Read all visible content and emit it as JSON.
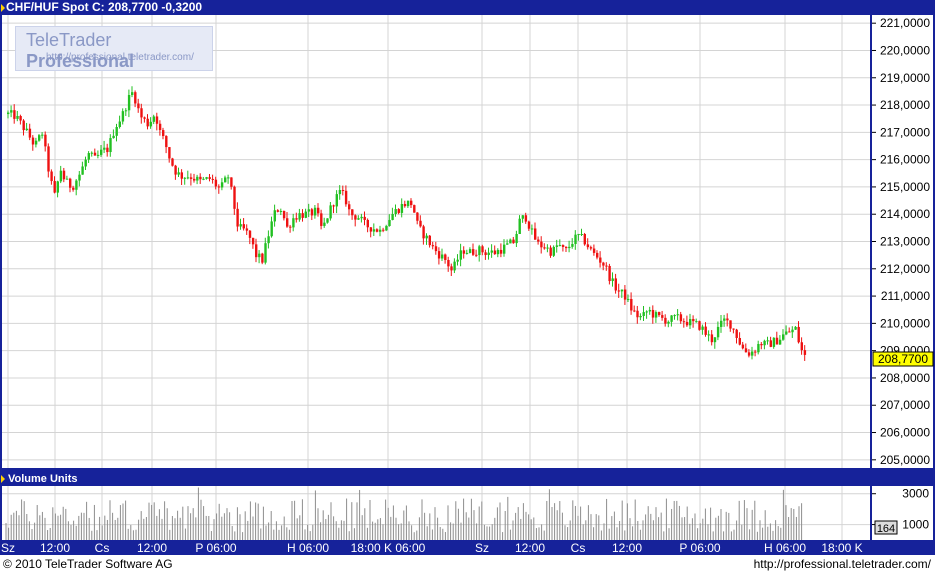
{
  "header": {
    "title": "CHF/HUF Spot C: 208,7700 -0,3200"
  },
  "logo": {
    "name_regular": "TeleTrader",
    "name_bold": "Professional",
    "url": "http://professional.teletrader.com/"
  },
  "volume_panel": {
    "title": "Volume Units",
    "last_value_label": "164"
  },
  "footer": {
    "copyright": "© 2010 TeleTrader Software AG",
    "url": "http://professional.teletrader.com/"
  },
  "colors": {
    "frame_blue": "#16229a",
    "up_candle": "#22c022",
    "down_candle": "#ee1111",
    "grid": "#d4d4d4",
    "last_price_highlight": "#ffff00"
  },
  "chart_data": [
    {
      "type": "candlestick",
      "title": "CHF/HUF Spot C: 208,7700 -0,3200",
      "last_value_label": "208,7700",
      "ylim": [
        204.7,
        221.3
      ],
      "yticks": [
        "221,0000",
        "220,0000",
        "219,0000",
        "218,0000",
        "217,0000",
        "216,0000",
        "215,0000",
        "214,0000",
        "213,0000",
        "212,0000",
        "211,0000",
        "210,0000",
        "209,0000",
        "208,0000",
        "207,0000",
        "206,0000",
        "205,0000"
      ],
      "ytick_values": [
        221,
        220,
        219,
        218,
        217,
        216,
        215,
        214,
        213,
        212,
        211,
        210,
        209,
        208,
        207,
        206,
        205
      ],
      "xticks": [
        "Sz",
        "12:00",
        "Cs",
        "12:00",
        "P 06:00",
        "H 06:00",
        "18:00 K 06:00",
        "Sz",
        "12:00",
        "Cs",
        "12:00",
        "P 06:00",
        "H 06:00",
        "18:00 K"
      ],
      "xtick_positions": [
        8,
        55,
        102,
        152,
        216,
        308,
        388,
        482,
        530,
        578,
        627,
        700,
        785,
        842
      ],
      "grid": true,
      "close_path": [
        [
          5,
          217.7
        ],
        [
          15,
          217.6
        ],
        [
          25,
          217.1
        ],
        [
          35,
          216.5
        ],
        [
          42,
          217.0
        ],
        [
          50,
          215.3
        ],
        [
          55,
          214.6
        ],
        [
          60,
          215.7
        ],
        [
          65,
          215.2
        ],
        [
          72,
          215.0
        ],
        [
          80,
          215.5
        ],
        [
          88,
          216.2
        ],
        [
          95,
          216.0
        ],
        [
          102,
          216.3
        ],
        [
          108,
          216.4
        ],
        [
          115,
          217.2
        ],
        [
          122,
          217.6
        ],
        [
          128,
          218.2
        ],
        [
          133,
          218.5
        ],
        [
          140,
          217.6
        ],
        [
          148,
          217.3
        ],
        [
          155,
          217.7
        ],
        [
          160,
          217.0
        ],
        [
          165,
          216.6
        ],
        [
          170,
          216.0
        ],
        [
          175,
          215.6
        ],
        [
          180,
          215.4
        ],
        [
          190,
          215.4
        ],
        [
          200,
          215.2
        ],
        [
          210,
          215.3
        ],
        [
          220,
          214.9
        ],
        [
          228,
          215.4
        ],
        [
          232,
          214.7
        ],
        [
          238,
          213.5
        ],
        [
          245,
          213.4
        ],
        [
          250,
          213.1
        ],
        [
          256,
          212.5
        ],
        [
          262,
          212.3
        ],
        [
          268,
          213.2
        ],
        [
          274,
          214.0
        ],
        [
          280,
          214.3
        ],
        [
          287,
          213.5
        ],
        [
          294,
          213.9
        ],
        [
          300,
          214.0
        ],
        [
          308,
          214.0
        ],
        [
          316,
          214.1
        ],
        [
          322,
          213.4
        ],
        [
          328,
          214.0
        ],
        [
          334,
          214.5
        ],
        [
          340,
          214.8
        ],
        [
          345,
          214.6
        ],
        [
          350,
          214.0
        ],
        [
          358,
          213.9
        ],
        [
          365,
          213.6
        ],
        [
          372,
          213.5
        ],
        [
          380,
          213.4
        ],
        [
          386,
          213.7
        ],
        [
          392,
          214.0
        ],
        [
          398,
          214.2
        ],
        [
          405,
          214.4
        ],
        [
          412,
          214.4
        ],
        [
          418,
          213.5
        ],
        [
          425,
          213.2
        ],
        [
          432,
          212.8
        ],
        [
          440,
          212.5
        ],
        [
          446,
          212.3
        ],
        [
          452,
          211.9
        ],
        [
          458,
          212.4
        ],
        [
          464,
          212.7
        ],
        [
          470,
          212.6
        ],
        [
          478,
          212.7
        ],
        [
          486,
          212.6
        ],
        [
          495,
          212.6
        ],
        [
          505,
          212.8
        ],
        [
          514,
          213.0
        ],
        [
          520,
          213.8
        ],
        [
          526,
          213.9
        ],
        [
          532,
          213.3
        ],
        [
          538,
          212.9
        ],
        [
          545,
          212.8
        ],
        [
          552,
          212.6
        ],
        [
          558,
          212.9
        ],
        [
          565,
          212.6
        ],
        [
          572,
          213.0
        ],
        [
          578,
          213.2
        ],
        [
          585,
          213.0
        ],
        [
          592,
          212.6
        ],
        [
          598,
          212.4
        ],
        [
          605,
          212.1
        ],
        [
          612,
          211.5
        ],
        [
          618,
          211.2
        ],
        [
          625,
          211.0
        ],
        [
          630,
          210.6
        ],
        [
          636,
          210.3
        ],
        [
          642,
          210.2
        ],
        [
          648,
          210.5
        ],
        [
          654,
          210.3
        ],
        [
          660,
          210.2
        ],
        [
          668,
          210.1
        ],
        [
          676,
          210.2
        ],
        [
          684,
          210.1
        ],
        [
          692,
          210.0
        ],
        [
          700,
          209.9
        ],
        [
          706,
          209.6
        ],
        [
          712,
          209.4
        ],
        [
          718,
          209.8
        ],
        [
          724,
          210.1
        ],
        [
          730,
          210.0
        ],
        [
          736,
          209.6
        ],
        [
          742,
          209.1
        ],
        [
          748,
          208.9
        ],
        [
          754,
          209.0
        ],
        [
          760,
          209.3
        ],
        [
          766,
          209.2
        ],
        [
          772,
          209.3
        ],
        [
          778,
          209.4
        ],
        [
          784,
          209.6
        ],
        [
          790,
          209.7
        ],
        [
          796,
          209.8
        ],
        [
          800,
          209.1
        ],
        [
          805,
          208.77
        ]
      ]
    },
    {
      "type": "bar",
      "title": "Volume Units",
      "ylim": [
        0,
        3500
      ],
      "yticks": [
        "3000",
        "1000"
      ],
      "ytick_values": [
        3000,
        1000
      ],
      "grid": true,
      "last_value": 164
    }
  ]
}
